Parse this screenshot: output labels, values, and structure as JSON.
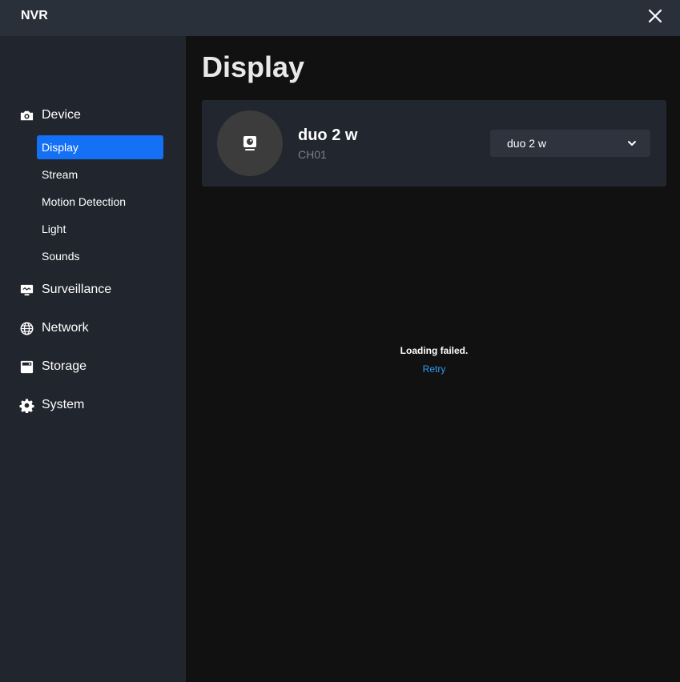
{
  "app": {
    "title": "NVR"
  },
  "sidebar": {
    "groups": [
      {
        "label": "Device",
        "icon": "camera-icon"
      },
      {
        "label": "Surveillance",
        "icon": "monitor-icon"
      },
      {
        "label": "Network",
        "icon": "globe-icon"
      },
      {
        "label": "Storage",
        "icon": "storage-icon"
      },
      {
        "label": "System",
        "icon": "gear-icon"
      }
    ],
    "device_items": [
      {
        "label": "Display",
        "active": true
      },
      {
        "label": "Stream",
        "active": false
      },
      {
        "label": "Motion Detection",
        "active": false
      },
      {
        "label": "Light",
        "active": false
      },
      {
        "label": "Sounds",
        "active": false
      }
    ]
  },
  "main": {
    "title": "Display",
    "device": {
      "name": "duo 2 w",
      "channel": "CH01",
      "selected": "duo 2 w"
    },
    "status": {
      "message": "Loading failed.",
      "retry_label": "Retry"
    }
  },
  "colors": {
    "accent": "#1470f5",
    "link": "#2f9bf4",
    "sidebar_bg": "#21252d",
    "titlebar_bg": "#2a303a",
    "main_bg": "#111111"
  }
}
